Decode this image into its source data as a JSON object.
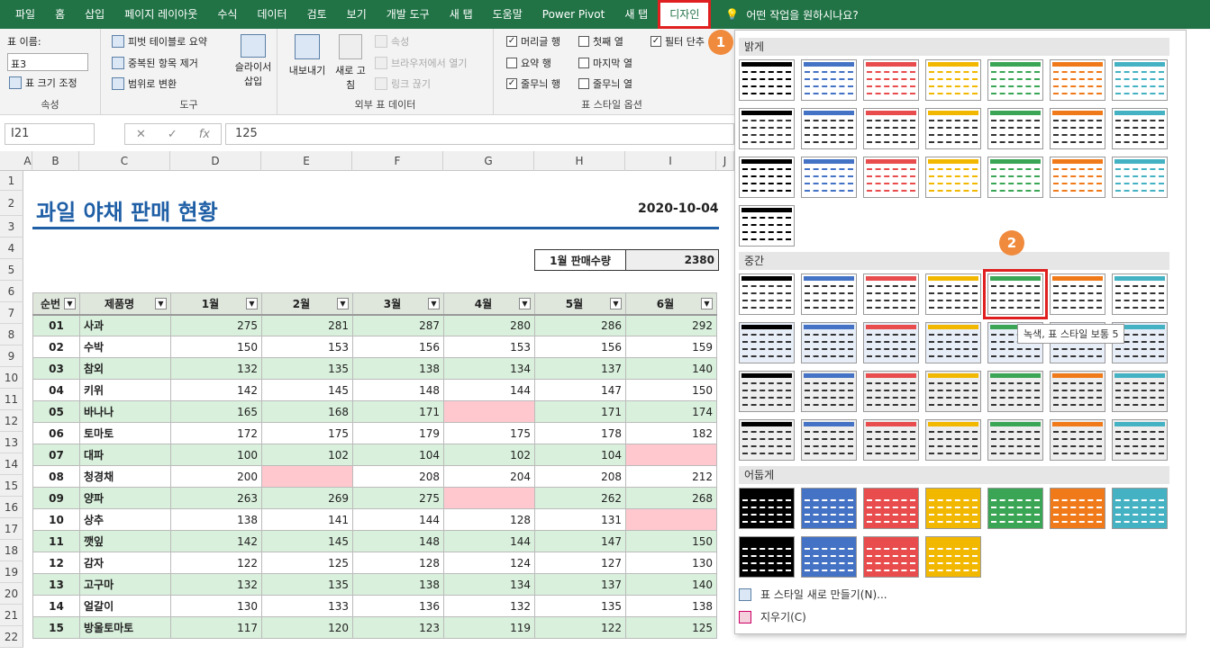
{
  "tabs": [
    "파일",
    "홈",
    "삽입",
    "페이지 레이아웃",
    "수식",
    "데이터",
    "검토",
    "보기",
    "개발 도구",
    "새 탭",
    "도움말",
    "Power Pivot",
    "새 탭",
    "디자인"
  ],
  "tell_me": "어떤 작업을 원하시나요?",
  "ribbon": {
    "props": {
      "label": "속성",
      "name_label": "표 이름:",
      "name_value": "표3",
      "resize": "표 크기 조정"
    },
    "tools": {
      "label": "도구",
      "pivot": "피벗 테이블로 요약",
      "dedupe": "중복된 항목 제거",
      "convert": "범위로 변환",
      "slicer": "슬라이서 삽입"
    },
    "external": {
      "label": "외부 표 데이터",
      "export": "내보내기",
      "refresh": "새로 고침",
      "props": "속성",
      "browser": "브라우저에서 열기",
      "unlink": "링크 끊기"
    },
    "options": {
      "label": "표 스타일 옵션",
      "header_row": "머리글 행",
      "first_col": "첫째 열",
      "filter": "필터 단추",
      "total_row": "요약 행",
      "last_col": "마지막 열",
      "banded_rows": "줄무늬 행",
      "banded_cols": "줄무늬 열"
    }
  },
  "formula": {
    "namebox": "I21",
    "value": "125",
    "fx": "fx"
  },
  "sheet": {
    "cols": [
      "A",
      "B",
      "C",
      "D",
      "E",
      "F",
      "G",
      "H",
      "I",
      "J"
    ],
    "rows": [
      "1",
      "2",
      "3",
      "4",
      "5",
      "6",
      "7",
      "8",
      "9",
      "10",
      "11",
      "12",
      "13",
      "14",
      "15",
      "16",
      "17",
      "18",
      "19",
      "20",
      "21",
      "22"
    ],
    "title": "과일 야채 판매 현황",
    "date": "2020-10-04",
    "sum_label": "1월 판매수량",
    "sum_value": "2380",
    "headers": [
      "순번",
      "제품명",
      "1월",
      "2월",
      "3월",
      "4월",
      "5월",
      "6월"
    ],
    "data": [
      [
        "01",
        "사과",
        "275",
        "281",
        "287",
        "280",
        "286",
        "292"
      ],
      [
        "02",
        "수박",
        "150",
        "153",
        "156",
        "153",
        "156",
        "159"
      ],
      [
        "03",
        "참외",
        "132",
        "135",
        "138",
        "134",
        "137",
        "140"
      ],
      [
        "04",
        "키위",
        "142",
        "145",
        "148",
        "144",
        "147",
        "150"
      ],
      [
        "05",
        "바나나",
        "165",
        "168",
        "171",
        "",
        "171",
        "174"
      ],
      [
        "06",
        "토마토",
        "172",
        "175",
        "179",
        "175",
        "178",
        "182"
      ],
      [
        "07",
        "대파",
        "100",
        "102",
        "104",
        "102",
        "104",
        ""
      ],
      [
        "08",
        "청경채",
        "200",
        "",
        "208",
        "204",
        "208",
        "212"
      ],
      [
        "09",
        "양파",
        "263",
        "269",
        "275",
        "",
        "262",
        "268"
      ],
      [
        "10",
        "상추",
        "138",
        "141",
        "144",
        "128",
        "131",
        ""
      ],
      [
        "11",
        "깻잎",
        "142",
        "145",
        "148",
        "144",
        "147",
        "150"
      ],
      [
        "12",
        "감자",
        "122",
        "125",
        "128",
        "124",
        "127",
        "130"
      ],
      [
        "13",
        "고구마",
        "132",
        "135",
        "138",
        "134",
        "137",
        "140"
      ],
      [
        "14",
        "얼갈이",
        "130",
        "133",
        "136",
        "132",
        "135",
        "138"
      ],
      [
        "15",
        "방울토마토",
        "117",
        "120",
        "123",
        "119",
        "122",
        "125"
      ]
    ]
  },
  "gallery": {
    "light": "밝게",
    "medium": "중간",
    "dark": "어둡게",
    "tooltip": "녹색, 표 스타일 보통 5",
    "new_style": "표 스타일 새로 만들기(N)...",
    "clear": "지우기(C)",
    "badge1": "1",
    "badge2": "2",
    "colors": [
      "#000000",
      "#4472c4",
      "#e84c4c",
      "#f2b800",
      "#3aa655",
      "#f07a1a",
      "#45b2c4"
    ]
  }
}
